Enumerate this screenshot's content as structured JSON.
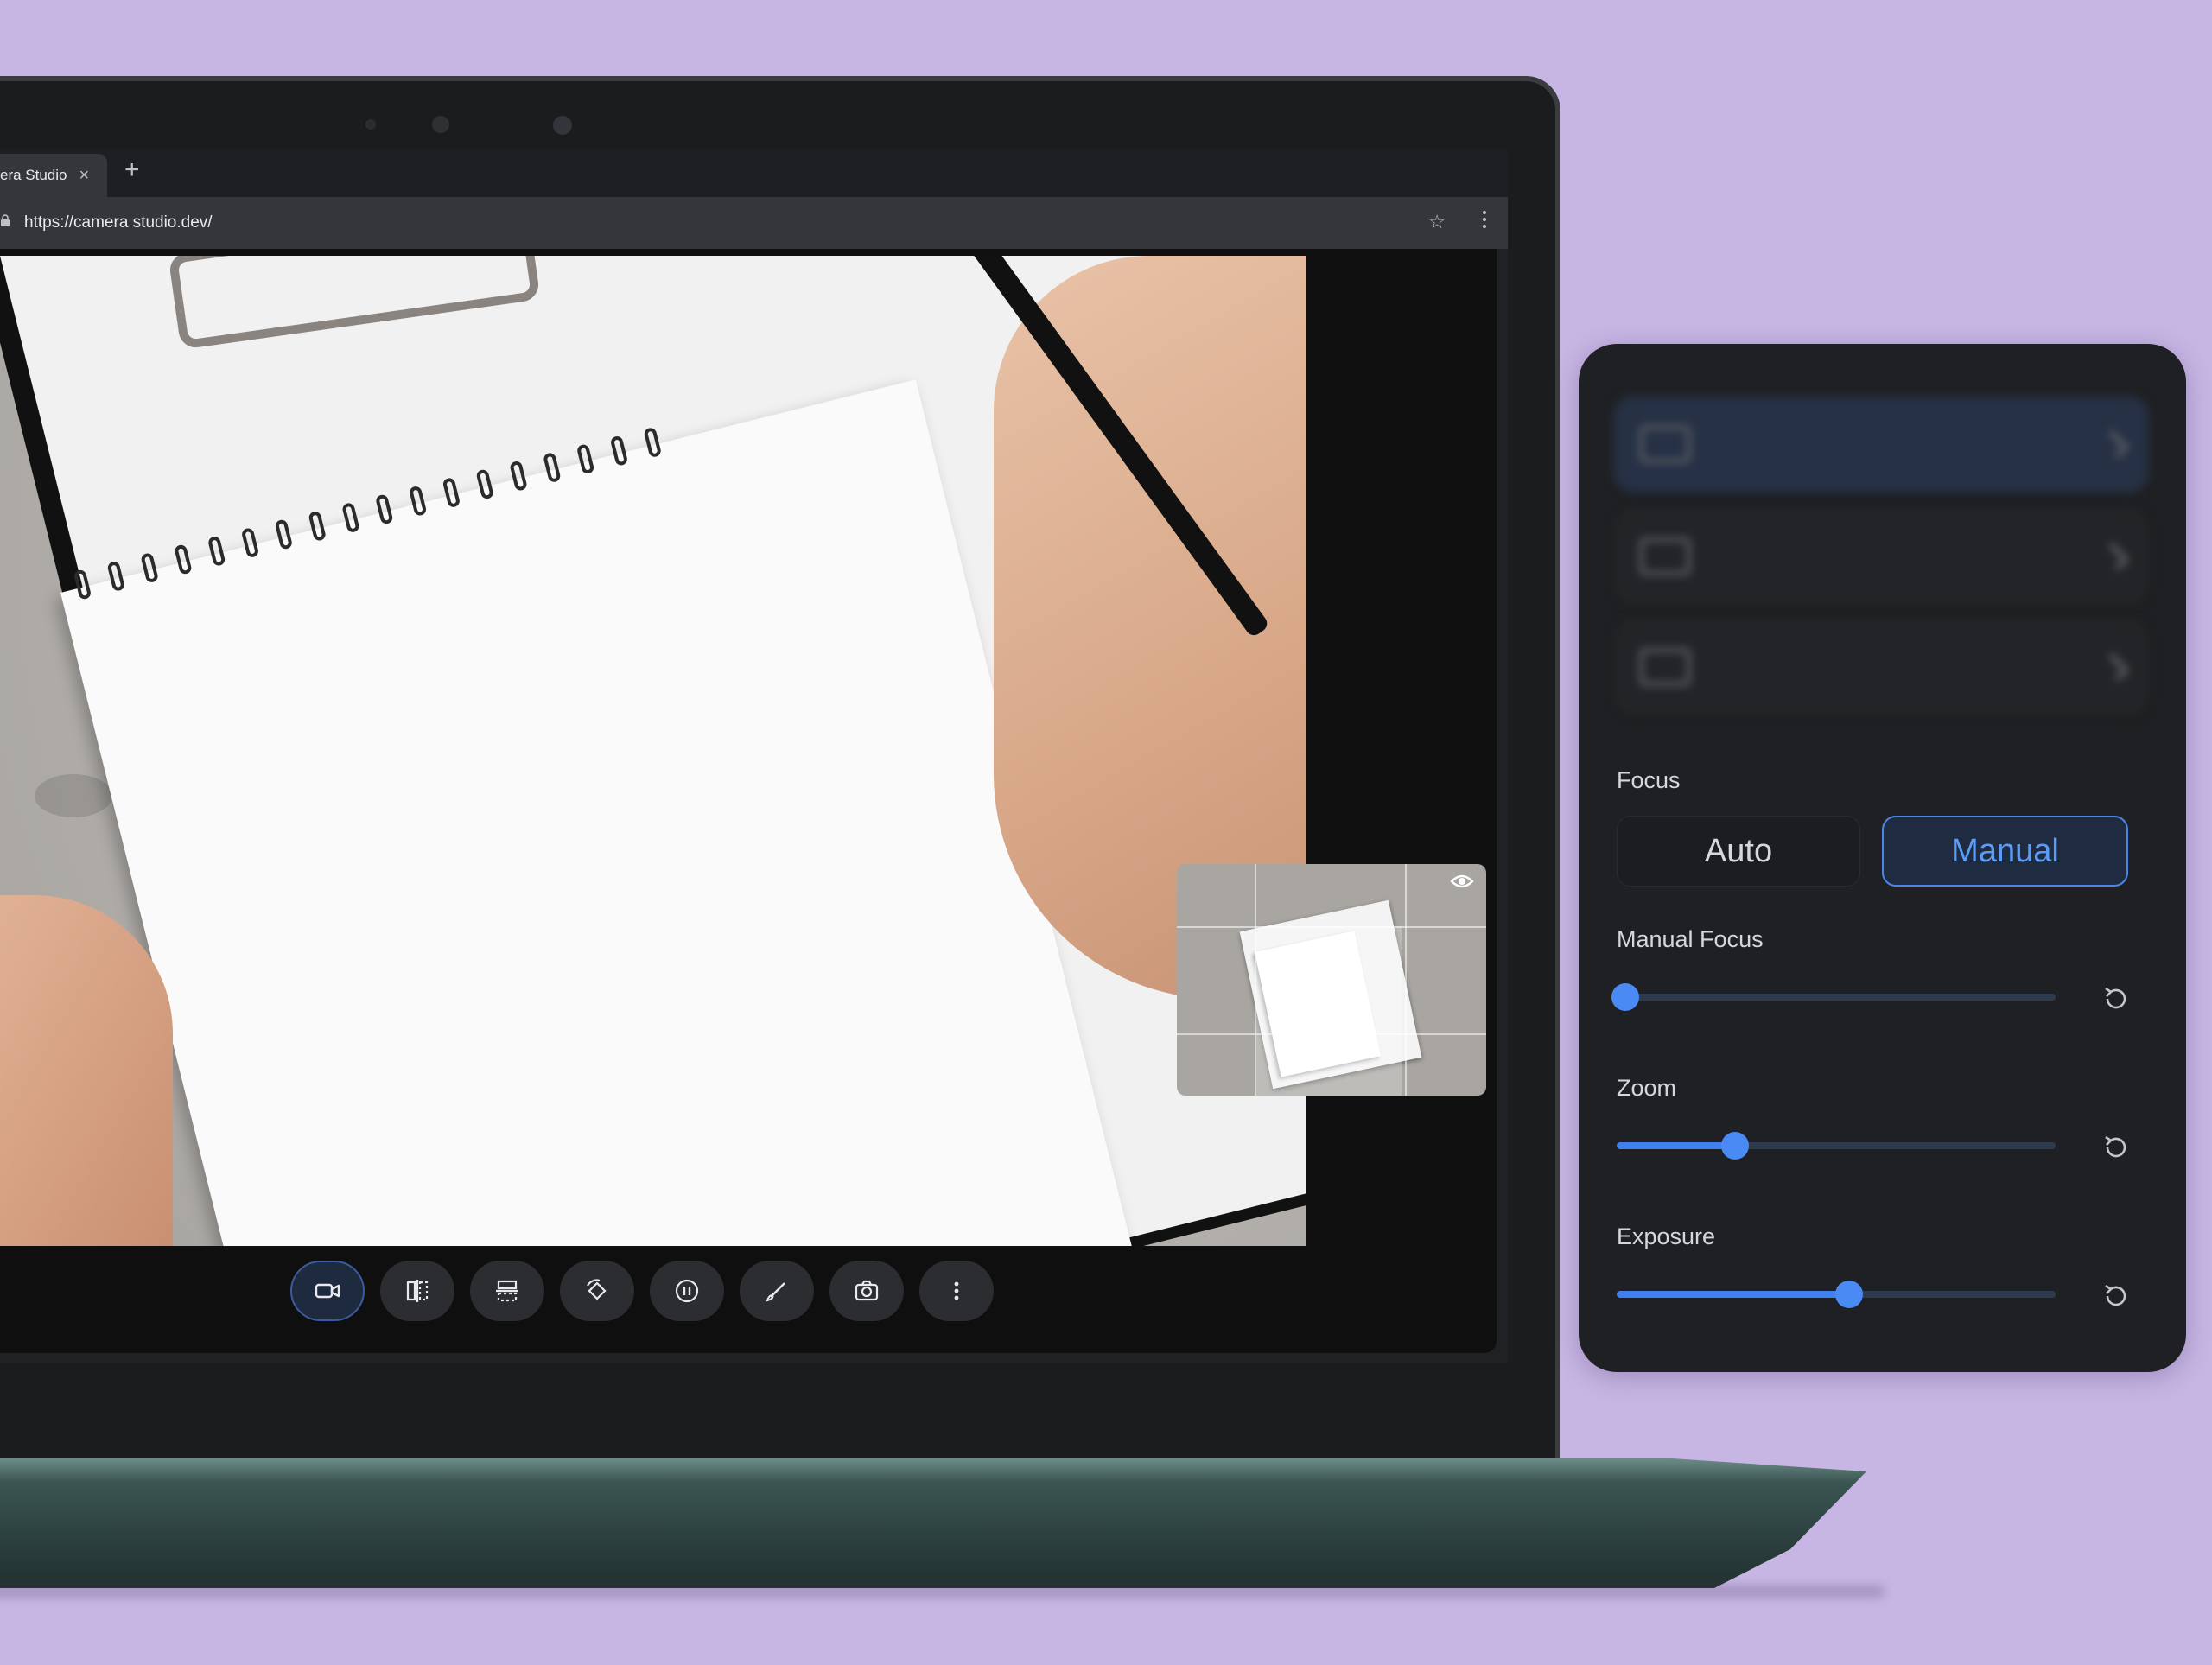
{
  "browser": {
    "tab_title": "era Studio",
    "tab_close": "×",
    "new_tab": "+",
    "url": "https://camera studio.dev/"
  },
  "toolbar_buttons": [
    {
      "name": "video-mode-button",
      "icon": "video-camera-icon",
      "active": true
    },
    {
      "name": "mirror-horizontal-button",
      "icon": "flip-horizontal-icon",
      "active": false
    },
    {
      "name": "mirror-vertical-button",
      "icon": "flip-vertical-icon",
      "active": false
    },
    {
      "name": "rotate-button",
      "icon": "rotate-icon",
      "active": false
    },
    {
      "name": "pause-button",
      "icon": "pause-icon",
      "active": false
    },
    {
      "name": "annotate-button",
      "icon": "brush-icon",
      "active": false
    },
    {
      "name": "snapshot-button",
      "icon": "camera-icon",
      "active": false
    },
    {
      "name": "more-options-button",
      "icon": "more-vert-icon",
      "active": false
    }
  ],
  "panel": {
    "focus_label": "Focus",
    "focus_options": {
      "auto": "Auto",
      "manual": "Manual"
    },
    "focus_selected": "Manual",
    "manual_focus_label": "Manual Focus",
    "manual_focus_value": 0.02,
    "zoom_label": "Zoom",
    "zoom_value": 0.27,
    "exposure_label": "Exposure",
    "exposure_value": 0.53
  },
  "colors": {
    "background": "#c7b6e4",
    "accent": "#4a8af4",
    "panel": "#1f2023"
  }
}
